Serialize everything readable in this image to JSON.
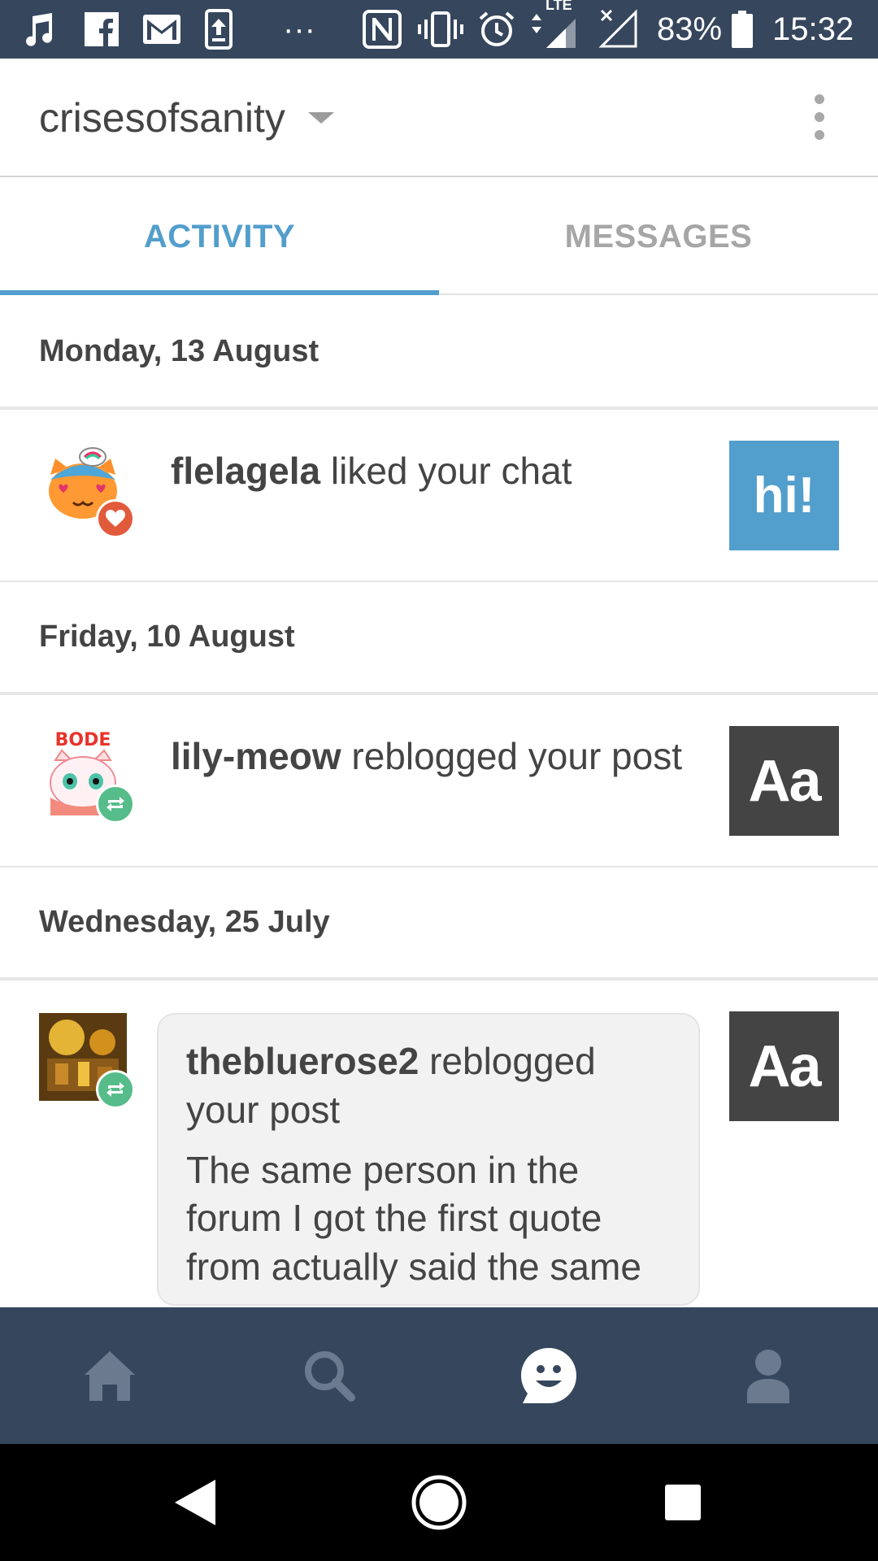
{
  "status_bar": {
    "battery": "83%",
    "time": "15:32",
    "lte_label": "LTE",
    "more_label": "···",
    "icons": [
      "music-icon",
      "facebook-icon",
      "gmail-icon",
      "upload-icon",
      "nfc-icon",
      "vibrate-icon",
      "alarm-icon",
      "lte-signal-icon",
      "no-signal-icon",
      "battery-icon"
    ]
  },
  "header": {
    "blog_name": "crisesofsanity",
    "menu_icon": "more-vertical-icon"
  },
  "tabs": [
    {
      "label": "ACTIVITY",
      "active": true
    },
    {
      "label": "MESSAGES",
      "active": false
    }
  ],
  "colors": {
    "accent": "#529ecc",
    "nav_bg": "#36465d",
    "like_badge": "#e25a3c",
    "reblog_badge": "#56bc8a"
  },
  "feed": {
    "groups": [
      {
        "date": "Monday, 13 August",
        "item": {
          "username": "flelagela",
          "action": "liked your chat",
          "badge": "heart-icon",
          "thumb_text": "hi!"
        }
      },
      {
        "date": "Friday, 10 August",
        "item": {
          "username": "lily-meow",
          "action": "reblogged your post",
          "badge": "reblog-icon",
          "avatar_text": "BODE",
          "thumb_text": "Aa"
        }
      },
      {
        "date": "Wednesday, 25 July",
        "item": {
          "username": "thebluerose2",
          "action": "reblogged your post",
          "badge": "reblog-icon",
          "body": "The same person in the forum I got the first quote from actually said the same",
          "thumb_text": "Aa"
        }
      }
    ]
  },
  "bottom_nav": [
    "home-icon",
    "search-icon",
    "activity-icon",
    "account-icon"
  ],
  "system_nav": [
    "back-icon",
    "home-circle-icon",
    "recents-icon"
  ]
}
